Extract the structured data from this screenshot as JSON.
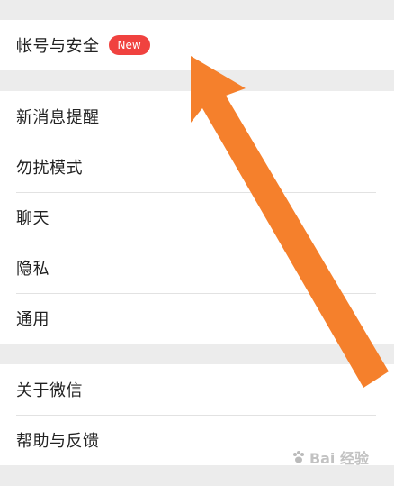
{
  "account": {
    "label": "帐号与安全",
    "badge": "New"
  },
  "group2": [
    {
      "label": "新消息提醒"
    },
    {
      "label": "勿扰模式"
    },
    {
      "label": "聊天"
    },
    {
      "label": "隐私"
    },
    {
      "label": "通用"
    }
  ],
  "group3": [
    {
      "label": "关于微信"
    },
    {
      "label": "帮助与反馈"
    }
  ],
  "annotation": {
    "arrow_color": "#f5802c"
  },
  "watermark": {
    "text": "Bai 经验",
    "icon": "paw-icon"
  }
}
